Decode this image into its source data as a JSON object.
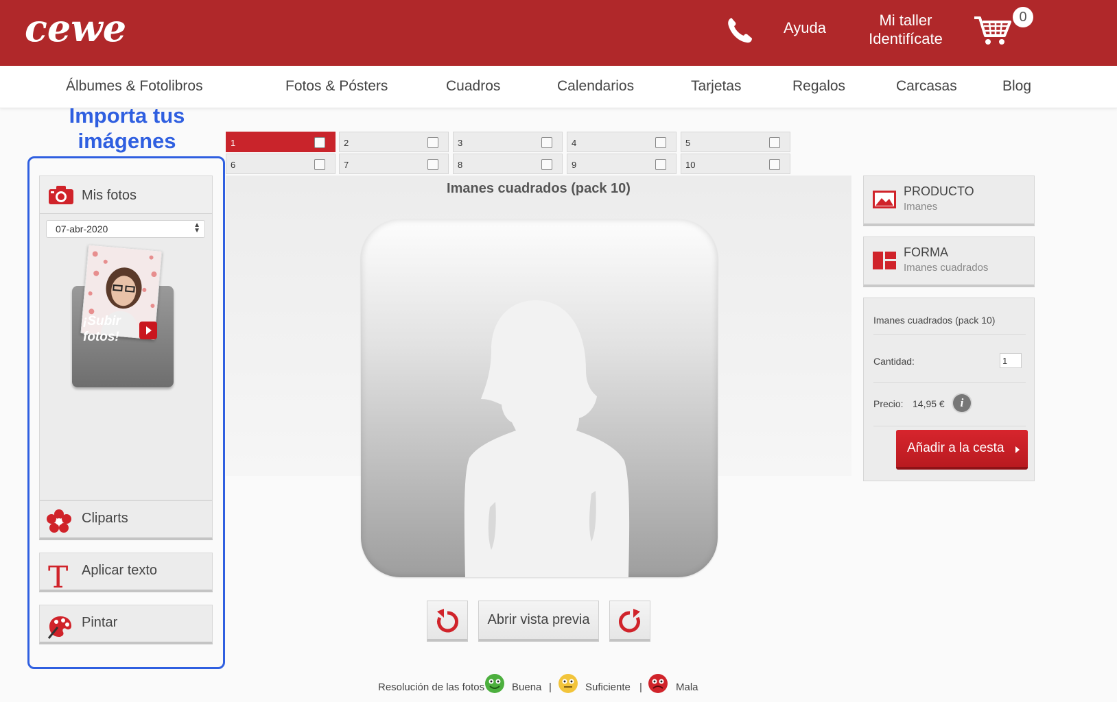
{
  "header": {
    "logo_text": "cewe",
    "help_label": "Ayuda",
    "account_line1": "Mi taller",
    "account_line2": "Identifícate",
    "cart_count": "0"
  },
  "nav": {
    "items": [
      "Álbumes & Fotolibros",
      "Fotos & Pósters",
      "Cuadros",
      "Calendarios",
      "Tarjetas",
      "Regalos",
      "Carcasas",
      "Blog"
    ]
  },
  "annotation": {
    "line1": "Importa tus",
    "line2": "imágenes"
  },
  "left_panel": {
    "my_photos_label": "Mis fotos",
    "date_value": "07-abr-2020",
    "upload_line1": "¡Subir",
    "upload_line2": "fotos!",
    "cliparts_label": "Cliparts",
    "text_label": "Aplicar texto",
    "paint_label": "Pintar"
  },
  "pages": {
    "items": [
      "1",
      "2",
      "3",
      "4",
      "5",
      "6",
      "7",
      "8",
      "9",
      "10"
    ],
    "active": "1"
  },
  "editor": {
    "product_title": "Imanes cuadrados (pack 10)",
    "preview_label": "Abrir vista previa"
  },
  "right_panel": {
    "product_title": "PRODUCTO",
    "product_value": "Imanes",
    "shape_title": "FORMA",
    "shape_value": "Imanes cuadrados",
    "order_name": "Imanes cuadrados (pack 10)",
    "quantity_label": "Cantidad:",
    "quantity_value": "1",
    "price_label": "Precio:",
    "price_value": "14,95 €",
    "info_symbol": "i",
    "add_to_cart_label": "Añadir a la cesta"
  },
  "legend": {
    "title": "Resolución de las fotos",
    "good": "Buena",
    "ok": "Suficiente",
    "bad": "Mala",
    "separator": "|"
  },
  "colors": {
    "brand_red": "#b0282a",
    "annotation_blue": "#2f5fe0",
    "good_green": "#4caf3e",
    "ok_yellow": "#f2c43a",
    "bad_red": "#d0232a"
  }
}
